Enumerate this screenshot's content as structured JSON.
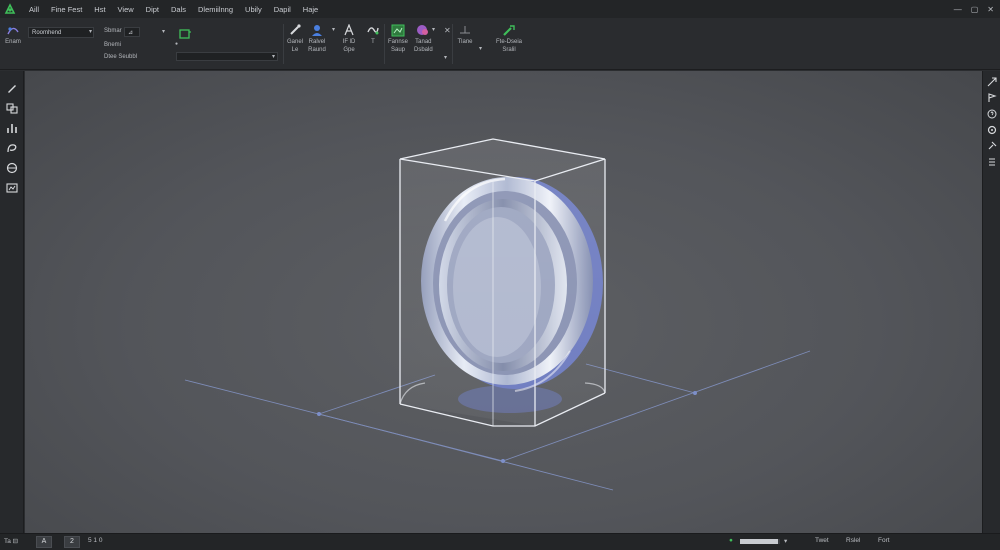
{
  "menubar": {
    "items": [
      "Aill",
      "Fine Fest",
      "Hst",
      "View",
      "Dipt",
      "Dals",
      "Dlemiilnng",
      "Ubily",
      "Dapil",
      "Haje"
    ]
  },
  "window_controls": {
    "minimize": "—",
    "maximize": "▢",
    "close": "✕"
  },
  "ribbon": {
    "frame_label": "Enam",
    "mode_field": "Roomhend",
    "small_labels": [
      "Sbmar",
      "Bnemi",
      "Dtee Seubbl"
    ],
    "small_field": "⊿",
    "group_a": {
      "line1": "Ganel",
      "line2": "Le"
    },
    "group_b": {
      "line1": "Ralvel",
      "line2": "Raund"
    },
    "group_c": {
      "line1": "IF lD",
      "line2": "Gpe"
    },
    "group_d": {
      "line1": "T"
    },
    "group_e": {
      "line1": "Fannse",
      "line2": "Saup"
    },
    "group_f": {
      "line1": "Tanad",
      "line2": "Dsbald"
    },
    "group_g": {
      "line1": "Tlane"
    },
    "group_h": {
      "line1": "Fte-Dseia",
      "line2": "Sralil"
    }
  },
  "statusbar": {
    "left_text": "Ta ⊟",
    "box_a": "A",
    "box_b": "2",
    "small_text": "5 1 0",
    "progress_value": 0.95,
    "right_items": [
      "Twet",
      "Rslel",
      "Fort"
    ]
  },
  "colors": {
    "accent_green": "#3fbf5a",
    "accent_blue": "#4a7fe0",
    "accent_purple": "#9b5cc4",
    "viewport_bg": "#56585c",
    "grid_line": "#7d8fc9"
  }
}
